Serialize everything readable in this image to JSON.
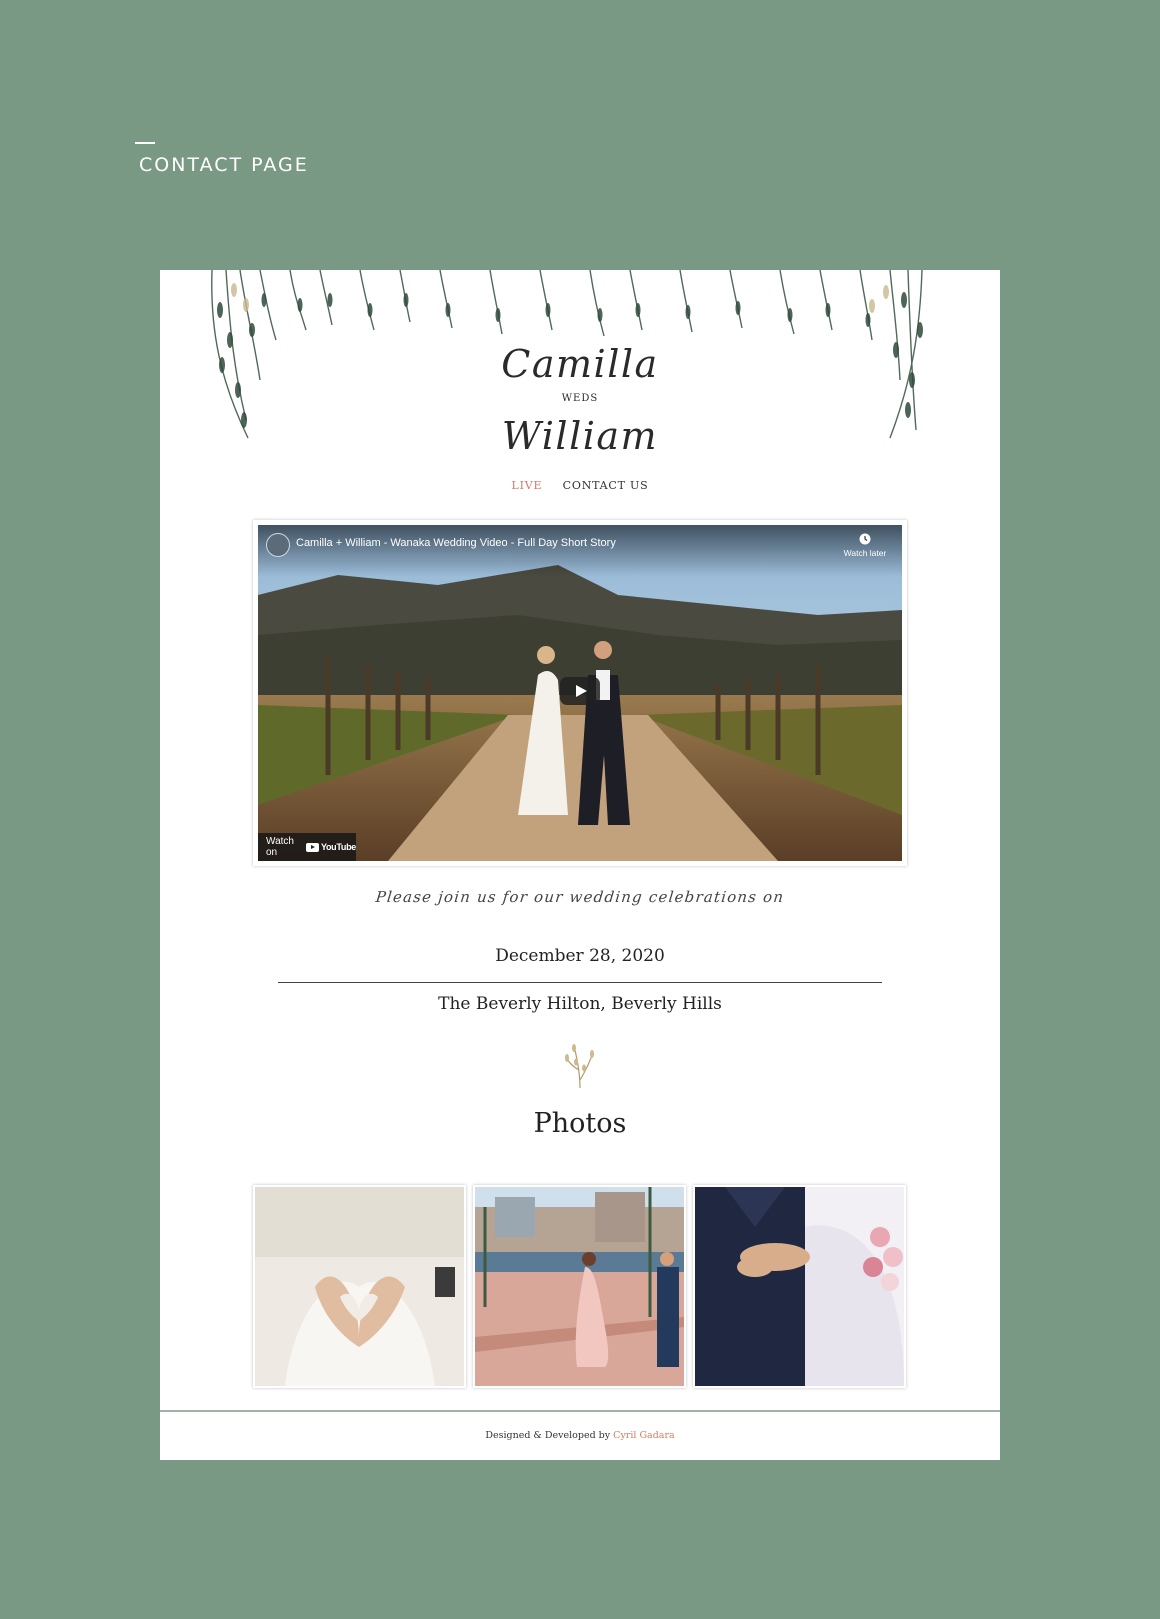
{
  "section_label": "CONTACT PAGE",
  "couple": {
    "name1": "Camilla",
    "weds": "WEDS",
    "name2": "William"
  },
  "nav": {
    "live": "LIVE",
    "contact": "CONTACT US"
  },
  "video": {
    "title": "Camilla + William - Wanaka Wedding Video - Full Day Short Story",
    "watch_later": "Watch later",
    "watch_on": "Watch on",
    "platform": "YouTube"
  },
  "invite_text": "Please join us for our wedding celebrations on",
  "date": "December 28, 2020",
  "venue": "The Beverly Hilton, Beverly Hills",
  "photos_title": "Photos",
  "footer": {
    "prefix": "Designed & Developed by",
    "author": "Cyril Gadara"
  },
  "colors": {
    "background": "#7a9985",
    "accent": "#d27c63",
    "card": "#ffffff"
  }
}
